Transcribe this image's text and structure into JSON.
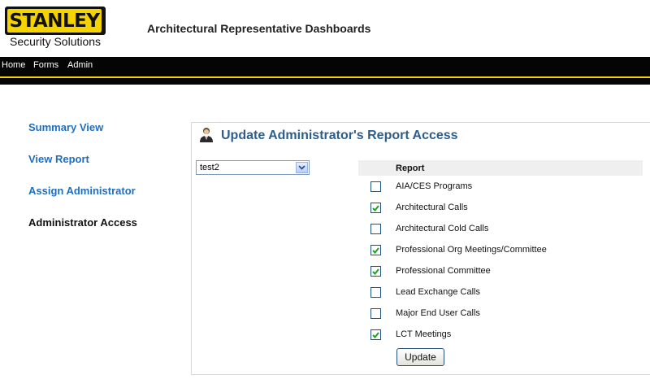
{
  "brand": {
    "logo_text": "STANLEY",
    "logo_subtitle": "Security Solutions",
    "accent_color": "#f5d300"
  },
  "header": {
    "title": "Architectural Representative Dashboards"
  },
  "nav": {
    "items": [
      {
        "label": "Home"
      },
      {
        "label": "Forms"
      },
      {
        "label": "Admin"
      }
    ]
  },
  "sidebar": {
    "items": [
      {
        "label": "Summary View",
        "current": false
      },
      {
        "label": "View Report",
        "current": false
      },
      {
        "label": "Assign Administrator",
        "current": false
      },
      {
        "label": "Administrator Access",
        "current": true
      }
    ]
  },
  "main": {
    "title": "Update Administrator's Report Access",
    "title_icon": "user-admin-icon",
    "admin_select": {
      "value": "test2"
    },
    "report_column_header": "Report",
    "reports": [
      {
        "label": "AIA/CES Programs",
        "checked": false
      },
      {
        "label": "Architectural Calls",
        "checked": true
      },
      {
        "label": "Architectural Cold Calls",
        "checked": false
      },
      {
        "label": "Professional Org Meetings/Committee",
        "checked": true
      },
      {
        "label": "Professional Committee",
        "checked": true
      },
      {
        "label": "Lead Exchange Calls",
        "checked": false
      },
      {
        "label": "Major End User Calls",
        "checked": false
      },
      {
        "label": "LCT Meetings",
        "checked": true
      }
    ],
    "update_label": "Update"
  }
}
